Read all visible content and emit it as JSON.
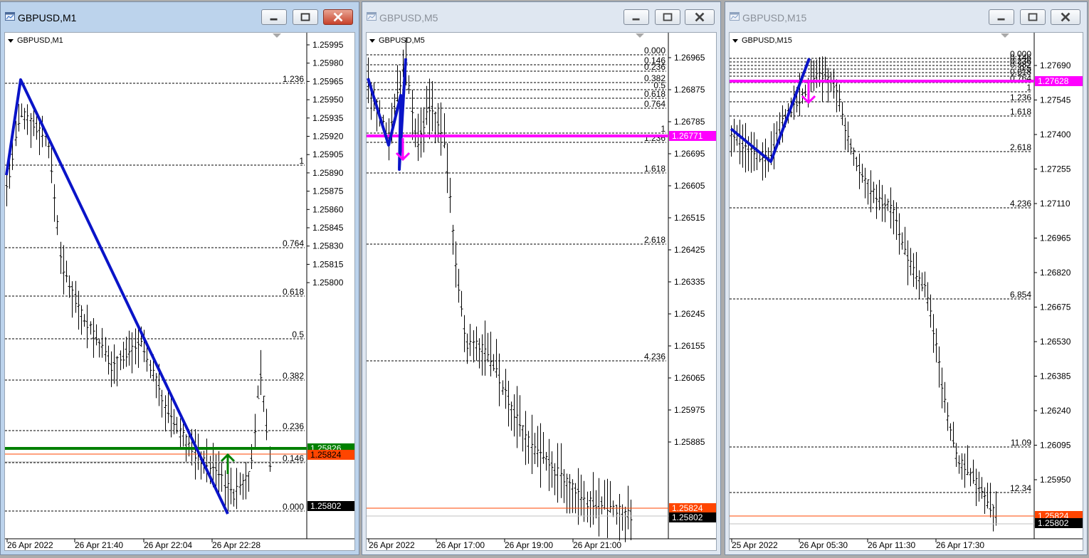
{
  "windows": [
    {
      "title": "GBPUSD,M1",
      "symbol": "GBPUSD,M1",
      "price_ticks": [
        "1.25995",
        "1.25980",
        "1.25965",
        "1.25950",
        "1.25935",
        "1.25920",
        "1.25905",
        "1.25890",
        "1.25875",
        "1.25860",
        "1.25845",
        "1.25830",
        "1.25815",
        "1.25800"
      ],
      "time_labels": [
        "26 Apr 2022",
        "26 Apr 21:40",
        "26 Apr 22:04",
        "26 Apr 22:28"
      ],
      "fib_labels": [
        "1.236",
        "1",
        "0.764",
        "0.618",
        "0.5",
        "0.382",
        "0.236",
        "0.146",
        "0.000"
      ],
      "price_tags": [
        "1.25826",
        "1.25824",
        "1.25802"
      ]
    },
    {
      "title": "GBPUSD,M5",
      "symbol": "GBPUSD,M5",
      "price_ticks": [
        "1.26965",
        "1.26875",
        "1.26785",
        "1.26695",
        "1.26605",
        "1.26515",
        "1.26425",
        "1.26335",
        "1.26245",
        "1.26155",
        "1.26065",
        "1.25975",
        "1.25885"
      ],
      "time_labels": [
        "26 Apr 2022",
        "26 Apr 17:00",
        "26 Apr 19:00",
        "26 Apr 21:00"
      ],
      "fib_labels": [
        "0.000",
        "0.146",
        "0.236",
        "0.382",
        "0.5",
        "0.618",
        "0.764",
        "1",
        "1.236",
        "1.618",
        "2.618",
        "4.236"
      ],
      "price_tags": [
        "1.26771",
        "1.25824",
        "1.25802"
      ]
    },
    {
      "title": "GBPUSD,M15",
      "symbol": "GBPUSD,M15",
      "price_ticks": [
        "1.27690",
        "1.27545",
        "1.27400",
        "1.27255",
        "1.27110",
        "1.26965",
        "1.26820",
        "1.26675",
        "1.26530",
        "1.26385",
        "1.26240",
        "1.26095",
        "1.25950"
      ],
      "time_labels": [
        "25 Apr 2022",
        "26 Apr 05:30",
        "26 Apr 11:30",
        "26 Apr 17:30"
      ],
      "fib_labels": [
        "0.000",
        "0.146",
        "0.236",
        "0.382",
        "0.5",
        "0.618",
        "0.764",
        "1",
        "1.236",
        "1.618",
        "2.618",
        "4.236",
        "6.854",
        "11.09",
        "12.34"
      ],
      "price_tags": [
        "1.27628",
        "1.25824",
        "1.25802"
      ]
    }
  ],
  "colors": {
    "zigzag": "#0a14c8",
    "fib_line": "#000000",
    "signal_line_m1": "#008000",
    "signal_line_m5": "#ff00ff",
    "signal_line_m15": "#ff00ff",
    "bid_line": "#ff4500",
    "tag_bid": "#000000"
  },
  "icons": {
    "window": "chart-window-icon",
    "minimize": "minimize-icon",
    "maximize": "maximize-icon",
    "close": "close-icon",
    "arrow_up": "arrow-up-icon",
    "arrow_down": "arrow-down-icon"
  }
}
